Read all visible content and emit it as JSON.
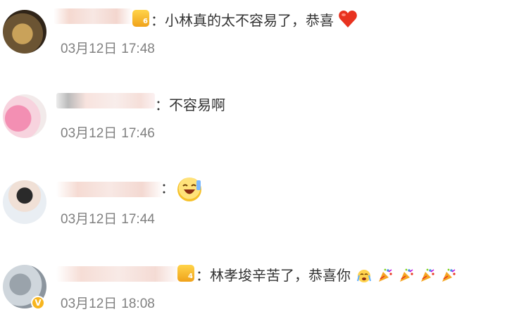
{
  "comments": [
    {
      "text": "：小林真的太不容易了，恭喜",
      "date": "03月12日",
      "time": "17:48",
      "badge_level": "6"
    },
    {
      "text": "：不容易啊",
      "date": "03月12日",
      "time": "17:46"
    },
    {
      "text": "：",
      "date": "03月12日",
      "time": "17:44"
    },
    {
      "text": "：林孝埈辛苦了，恭喜你",
      "date": "03月12日",
      "time": "18:08",
      "badge_level": "4",
      "vip_mark": "V"
    }
  ],
  "colors": {
    "text": "#333333",
    "time": "#808080",
    "heart": "#e8321f",
    "badge": "#f5b128"
  },
  "icons": [
    "heart-icon",
    "laughing-face-icon",
    "crying-face-icon",
    "party-popper-icon",
    "vip-badge-icon",
    "level-badge-icon"
  ]
}
